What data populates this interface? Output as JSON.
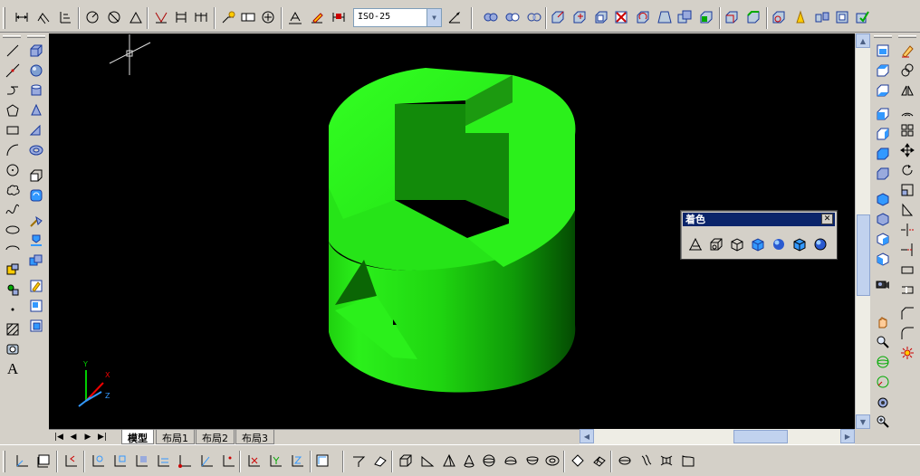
{
  "toolbar": {
    "dimension_style": "ISO-25",
    "dimension_style_arrow": "▼"
  },
  "shade_panel": {
    "title": "着色",
    "close": "✕"
  },
  "layout_tabs": {
    "model": "模型",
    "layout1": "布局1",
    "layout2": "布局2",
    "layout3": "布局3"
  },
  "nav_glyphs": {
    "first": "|◀",
    "prev": "◀",
    "next": "▶",
    "last": "▶|"
  },
  "draw_toolbar": {
    "text_icon": "A"
  },
  "ucs_icon": {
    "x": "X",
    "y": "Y",
    "z": "Z"
  },
  "colors": {
    "model_green": "#2bf01b",
    "background": "#000000",
    "title_bar": "#0a246a",
    "chrome": "#d4d0c8"
  }
}
